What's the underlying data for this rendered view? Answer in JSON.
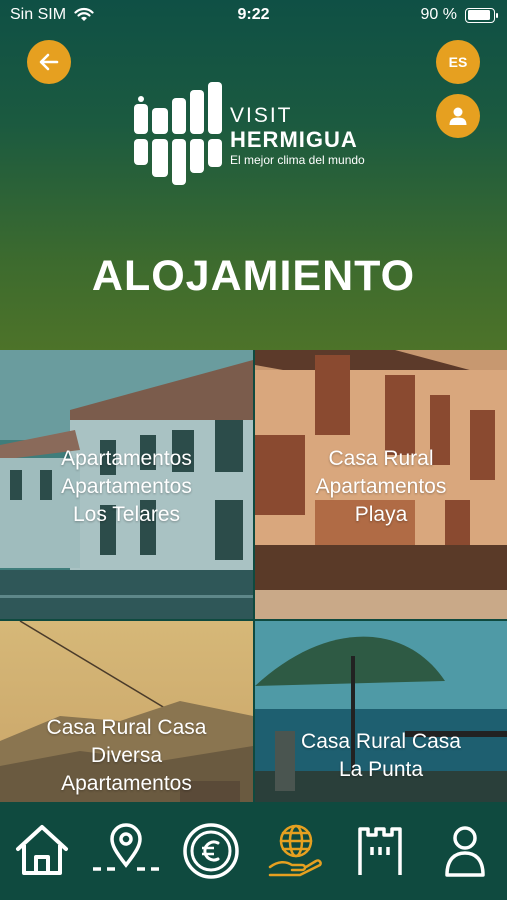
{
  "status_bar": {
    "carrier": "Sin SIM",
    "time": "9:22",
    "battery_text": "90 %",
    "battery_level": 0.9
  },
  "header": {
    "language": "ES",
    "logo": {
      "visit": "VISIT",
      "name": "HERMIGUA",
      "tagline": "El mejor clima del mundo"
    },
    "title": "ALOJAMIENTO"
  },
  "listings": [
    {
      "lines": [
        "Apartamentos",
        "Apartamentos",
        "Los Telares"
      ]
    },
    {
      "lines": [
        "Casa Rural",
        "Apartamentos",
        "Playa"
      ]
    },
    {
      "lines": [
        "Casa Rural Casa",
        "Diversa",
        "Apartamentos"
      ]
    },
    {
      "lines": [
        "Casa Rural Casa",
        "La Punta"
      ]
    }
  ],
  "tabbar": {
    "accent": "#e6a020",
    "items": [
      {
        "icon": "home-icon",
        "active": false
      },
      {
        "icon": "location-pin-icon",
        "active": false
      },
      {
        "icon": "euro-coin-icon",
        "active": false
      },
      {
        "icon": "globe-hand-icon",
        "active": true
      },
      {
        "icon": "castle-tower-icon",
        "active": false
      },
      {
        "icon": "person-icon",
        "active": false
      }
    ]
  },
  "colors": {
    "primary_green": "#0f4a3f",
    "accent_orange": "#e6a020"
  }
}
